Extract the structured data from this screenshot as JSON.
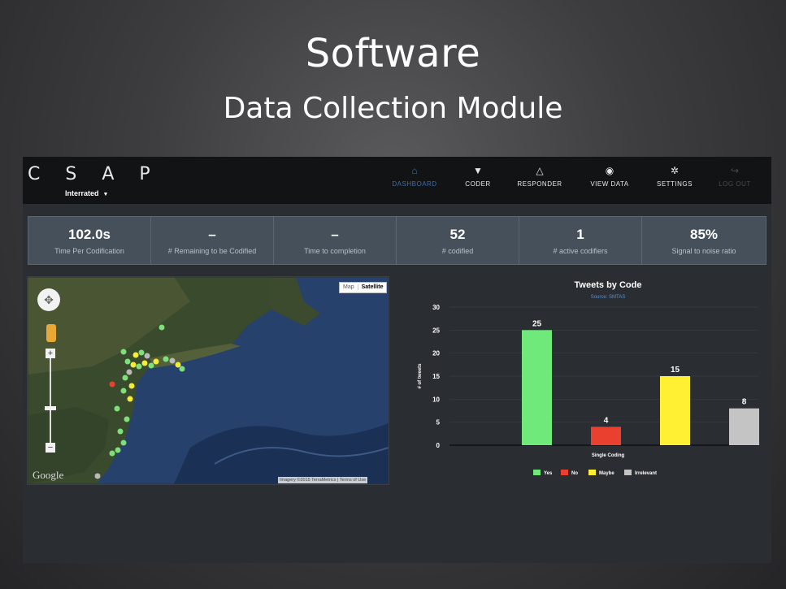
{
  "slide": {
    "title": "Software",
    "subtitle": "Data Collection Module"
  },
  "app": {
    "brand": "C S A P",
    "selector": "Interrated",
    "nav": [
      {
        "label": "DASHBOARD",
        "icon": "home-icon",
        "glyph": "⌂"
      },
      {
        "label": "CODER",
        "icon": "filter-icon",
        "glyph": "▼"
      },
      {
        "label": "RESPONDER",
        "icon": "warning-icon",
        "glyph": "△"
      },
      {
        "label": "VIEW DATA",
        "icon": "eye-icon",
        "glyph": "◉"
      },
      {
        "label": "SETTINGS",
        "icon": "gear-icon",
        "glyph": "✲"
      },
      {
        "label": "LOG OUT",
        "icon": "logout-icon",
        "glyph": "↪"
      }
    ],
    "stats": [
      {
        "value": "102.0s",
        "label": "Time Per Codification"
      },
      {
        "value": "–",
        "label": "# Remaining to be Codified"
      },
      {
        "value": "–",
        "label": "Time to completion"
      },
      {
        "value": "52",
        "label": "# codified"
      },
      {
        "value": "1",
        "label": "# active codifiers"
      },
      {
        "value": "85%",
        "label": "Signal to noise ratio"
      }
    ],
    "map": {
      "toggle": [
        "Map",
        "Satellite"
      ],
      "zoom_in": "+",
      "zoom_out": "−",
      "logo": "Google",
      "attribution": "Imagery ©2015 TerraMetrics | Terms of Use"
    }
  },
  "chart_data": {
    "type": "bar",
    "title": "Tweets by Code",
    "subtitle": "Source: SMTAS",
    "xlabel": "Single Coding",
    "ylabel": "# of tweets",
    "ylim": [
      0,
      30
    ],
    "yticks": [
      0,
      5,
      10,
      15,
      20,
      25,
      30
    ],
    "categories": [
      "Yes",
      "No",
      "Maybe",
      "Irrelevant"
    ],
    "values": [
      25,
      4,
      15,
      8
    ],
    "colors": [
      "#6fe97a",
      "#e9402f",
      "#fff033",
      "#c4c4c4"
    ],
    "legend_position": "bottom",
    "grid": true
  }
}
